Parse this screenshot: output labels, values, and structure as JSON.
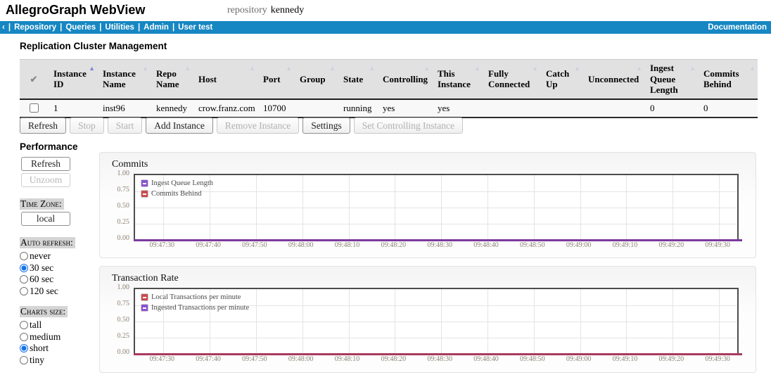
{
  "colors": {
    "nav_bg": "#1687c2",
    "table_header_bg": "#e1e1e1",
    "radio_accent": "#1673e6"
  },
  "header": {
    "app_title": "AllegroGraph WebView",
    "repo_label": "repository",
    "repo_name": "kennedy"
  },
  "nav": {
    "back": "‹",
    "separator": "|",
    "items": [
      "Repository",
      "Queries",
      "Utilities",
      "Admin",
      "User test"
    ],
    "doc_link": "Documentation"
  },
  "cluster": {
    "title": "Replication Cluster Management",
    "check_glyph": "✔",
    "sort_arrow": "▲",
    "columns": [
      "Instance ID",
      "Instance Name",
      "Repo Name",
      "Host",
      "Port",
      "Group",
      "State",
      "Controlling",
      "This Instance",
      "Fully Connected",
      "Catch Up",
      "Unconnected",
      "Ingest Queue Length",
      "Commits Behind"
    ],
    "rows": [
      {
        "checked": false,
        "cells": [
          "1",
          "inst96",
          "kennedy",
          "crow.franz.com",
          "10700",
          "",
          "running",
          "yes",
          "yes",
          "",
          "",
          "",
          "0",
          "0"
        ]
      }
    ],
    "buttons": [
      {
        "label": "Refresh",
        "enabled": true
      },
      {
        "label": "Stop",
        "enabled": false
      },
      {
        "label": "Start",
        "enabled": false
      },
      {
        "label": "Add Instance",
        "enabled": true
      },
      {
        "label": "Remove Instance",
        "enabled": false
      },
      {
        "label": "Settings",
        "enabled": true
      },
      {
        "label": "Set Controlling Instance",
        "enabled": false
      }
    ]
  },
  "performance": {
    "title": "Performance",
    "buttons": [
      {
        "label": "Refresh",
        "enabled": true
      },
      {
        "label": "Unzoom",
        "enabled": false
      }
    ],
    "time_zone": {
      "label": "Time Zone:",
      "value": "local"
    },
    "radio_groups": [
      {
        "label": "Auto refresh:",
        "options": [
          "never",
          "30 sec",
          "60 sec",
          "120 sec"
        ],
        "selected": "30 sec"
      },
      {
        "label": "Charts size:",
        "options": [
          "tall",
          "medium",
          "short",
          "tiny"
        ],
        "selected": "short"
      }
    ]
  },
  "chart_data": [
    {
      "type": "line",
      "title": "Commits",
      "x": [
        "09:47:30",
        "09:47:40",
        "09:47:50",
        "09:48:00",
        "09:48:10",
        "09:48:20",
        "09:48:30",
        "09:48:40",
        "09:48:50",
        "09:49:00",
        "09:49:10",
        "09:49:20",
        "09:49:30"
      ],
      "y_ticks": [
        "1.00",
        "0.75",
        "0.50",
        "0.25",
        "0.00"
      ],
      "ylim": [
        0,
        1
      ],
      "grid": true,
      "legend_position": "top-left",
      "series": [
        {
          "name": "Ingest Queue Length",
          "color": "#8a52d1",
          "values": [
            0,
            0,
            0,
            0,
            0,
            0,
            0,
            0,
            0,
            0,
            0,
            0,
            0
          ]
        },
        {
          "name": "Commits Behind",
          "color": "#cb4b4b",
          "values": [
            0,
            0,
            0,
            0,
            0,
            0,
            0,
            0,
            0,
            0,
            0,
            0,
            0
          ]
        }
      ],
      "baseline_color": "#7c3a9d"
    },
    {
      "type": "line",
      "title": "Transaction Rate",
      "x": [
        "09:47:30",
        "09:47:40",
        "09:47:50",
        "09:48:00",
        "09:48:10",
        "09:48:20",
        "09:48:30",
        "09:48:40",
        "09:48:50",
        "09:49:00",
        "09:49:10",
        "09:49:20",
        "09:49:30"
      ],
      "y_ticks": [
        "1.00",
        "0.75",
        "0.50",
        "0.25",
        "0.00"
      ],
      "ylim": [
        0,
        1
      ],
      "grid": true,
      "legend_position": "top-left",
      "series": [
        {
          "name": "Local Transactions per minute",
          "color": "#cb4b4b",
          "values": [
            0,
            0,
            0,
            0,
            0,
            0,
            0,
            0,
            0,
            0,
            0,
            0,
            0
          ]
        },
        {
          "name": "Ingested Transactions per minute",
          "color": "#8a52d1",
          "values": [
            0,
            0,
            0,
            0,
            0,
            0,
            0,
            0,
            0,
            0,
            0,
            0,
            0
          ]
        }
      ],
      "baseline_color": "#a93a5e"
    }
  ]
}
